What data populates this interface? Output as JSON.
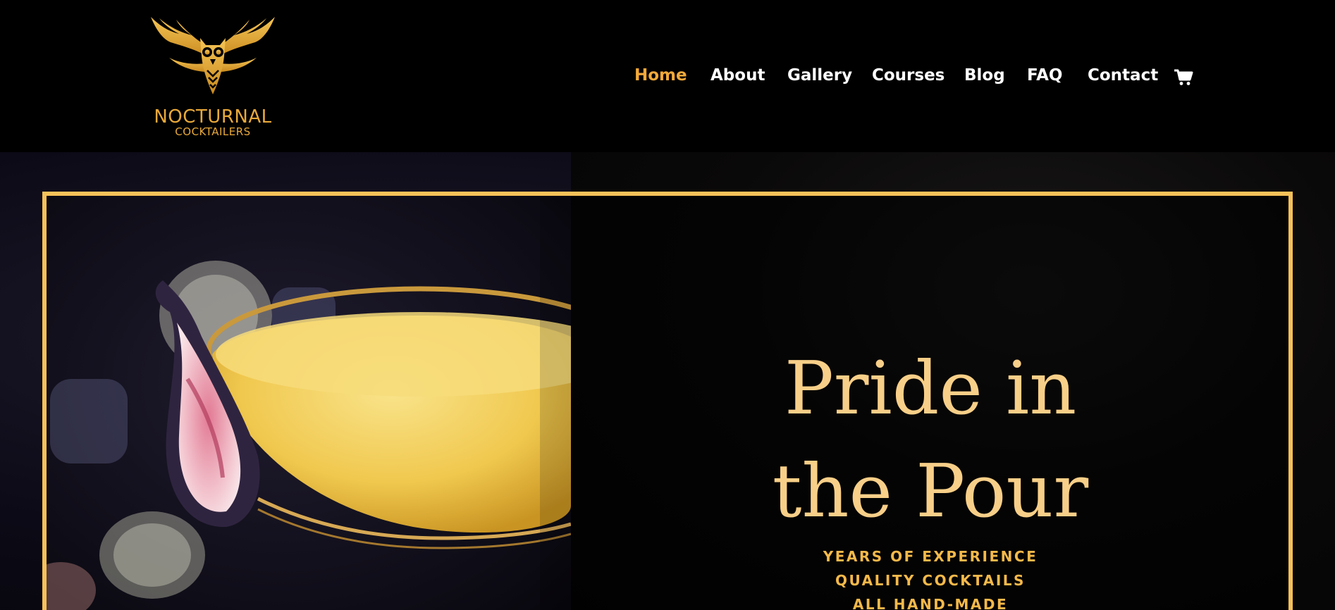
{
  "brand": {
    "name": "NOCTURNAL",
    "subtitle": "COCKTAILERS",
    "logo_icon": "owl-wings-logo",
    "color": "#e9a93a"
  },
  "nav": {
    "items": [
      {
        "label": "Home",
        "active": true
      },
      {
        "label": "About",
        "active": false
      },
      {
        "label": "Gallery",
        "active": false
      },
      {
        "label": "Courses",
        "active": false
      },
      {
        "label": "Blog",
        "active": false
      },
      {
        "label": "FAQ",
        "active": false
      },
      {
        "label": "Contact",
        "active": false
      }
    ],
    "cart_icon": "shopping-cart-icon",
    "active_color": "#f3a93a"
  },
  "hero": {
    "headline_line1": "Pride in",
    "headline_line2": "the Pour",
    "taglines": [
      "YEARS OF EXPERIENCE",
      "QUALITY COCKTAILS",
      "ALL HAND-MADE"
    ],
    "frame_color": "#f7c259",
    "headline_color": "#f8cf88",
    "image_subject": "fig-garnished-cocktail-coupe"
  }
}
